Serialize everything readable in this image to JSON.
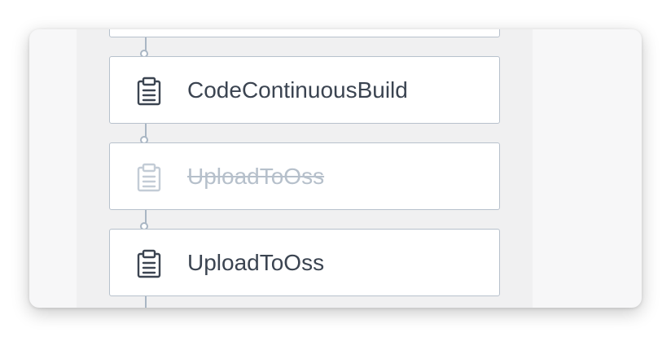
{
  "pipeline": {
    "steps": [
      {
        "label": "",
        "icon": "clipboard-icon",
        "enabled": true
      },
      {
        "label": "CodeContinuousBuild",
        "icon": "clipboard-icon",
        "enabled": true
      },
      {
        "label": "UploadToOss",
        "icon": "clipboard-icon",
        "enabled": false
      },
      {
        "label": "UploadToOss",
        "icon": "clipboard-icon",
        "enabled": true
      }
    ]
  },
  "colors": {
    "step_text": "#3b4451",
    "disabled_text": "#b6c0cb",
    "connector": "#a9b6c4",
    "step_border": "#b7c1cc"
  }
}
